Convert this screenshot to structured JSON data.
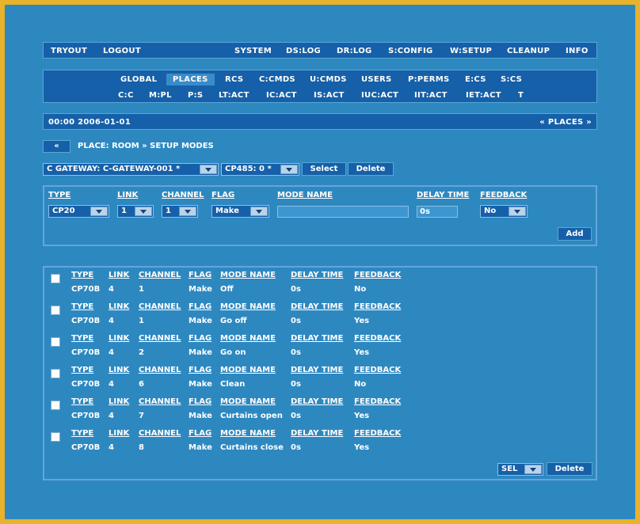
{
  "topnav": [
    "TRYOUT",
    "LOGOUT",
    "SYSTEM",
    "DS:LOG",
    "DR:LOG",
    "S:CONFIG",
    "W:SETUP",
    "CLEANUP",
    "INFO"
  ],
  "places_nav": {
    "row1": [
      "GLOBAL",
      "PLACES",
      "RCS",
      "C:CMDS",
      "U:CMDS",
      "USERS",
      "P:PERMS",
      "E:CS",
      "S:CS"
    ],
    "row2": [
      "C:C",
      "M:PL",
      "P:S",
      "LT:ACT",
      "IC:ACT",
      "IS:ACT",
      "IUC:ACT",
      "IIT:ACT",
      "IET:ACT",
      "T"
    ],
    "active": "PLACES"
  },
  "status": {
    "datetime": "00:00 2006-01-01",
    "places_link": "« PLACES »"
  },
  "breadcrumb": {
    "back": "«",
    "path": "PLACE: ROOM  »  SETUP MODES"
  },
  "selectors": {
    "gateway": "C GATEWAY: C-GATEWAY-001 *",
    "cp485": "CP485: 0 *",
    "select_label": "Select",
    "delete_label": "Delete"
  },
  "add_form": {
    "headers": {
      "type": "TYPE",
      "link": "LINK",
      "channel": "CHANNEL",
      "flag": "FLAG",
      "mode_name": "MODE NAME",
      "delay_time": "DELAY TIME",
      "feedback": "FEEDBACK"
    },
    "values": {
      "type": "CP20",
      "link": "1",
      "channel": "1",
      "flag": "Make",
      "mode_name": "",
      "delay_time": "0s",
      "feedback": "No"
    },
    "add_label": "Add"
  },
  "modes": {
    "headers": {
      "type": "TYPE",
      "link": "LINK",
      "channel": "CHANNEL",
      "flag": "FLAG",
      "mode_name": "MODE NAME",
      "delay_time": "DELAY TIME",
      "feedback": "FEEDBACK"
    },
    "rows": [
      {
        "type": "CP70B",
        "link": "4",
        "channel": "1",
        "flag": "Make",
        "mode_name": "Off",
        "delay_time": "0s",
        "feedback": "No"
      },
      {
        "type": "CP70B",
        "link": "4",
        "channel": "1",
        "flag": "Make",
        "mode_name": "Go off",
        "delay_time": "0s",
        "feedback": "Yes"
      },
      {
        "type": "CP70B",
        "link": "4",
        "channel": "2",
        "flag": "Make",
        "mode_name": "Go on",
        "delay_time": "0s",
        "feedback": "Yes"
      },
      {
        "type": "CP70B",
        "link": "4",
        "channel": "6",
        "flag": "Make",
        "mode_name": "Clean",
        "delay_time": "0s",
        "feedback": "No"
      },
      {
        "type": "CP70B",
        "link": "4",
        "channel": "7",
        "flag": "Make",
        "mode_name": "Curtains open",
        "delay_time": "0s",
        "feedback": "Yes"
      },
      {
        "type": "CP70B",
        "link": "4",
        "channel": "8",
        "flag": "Make",
        "mode_name": "Curtains close",
        "delay_time": "0s",
        "feedback": "Yes"
      }
    ],
    "bulk_select": "SEL",
    "delete_label": "Delete"
  }
}
